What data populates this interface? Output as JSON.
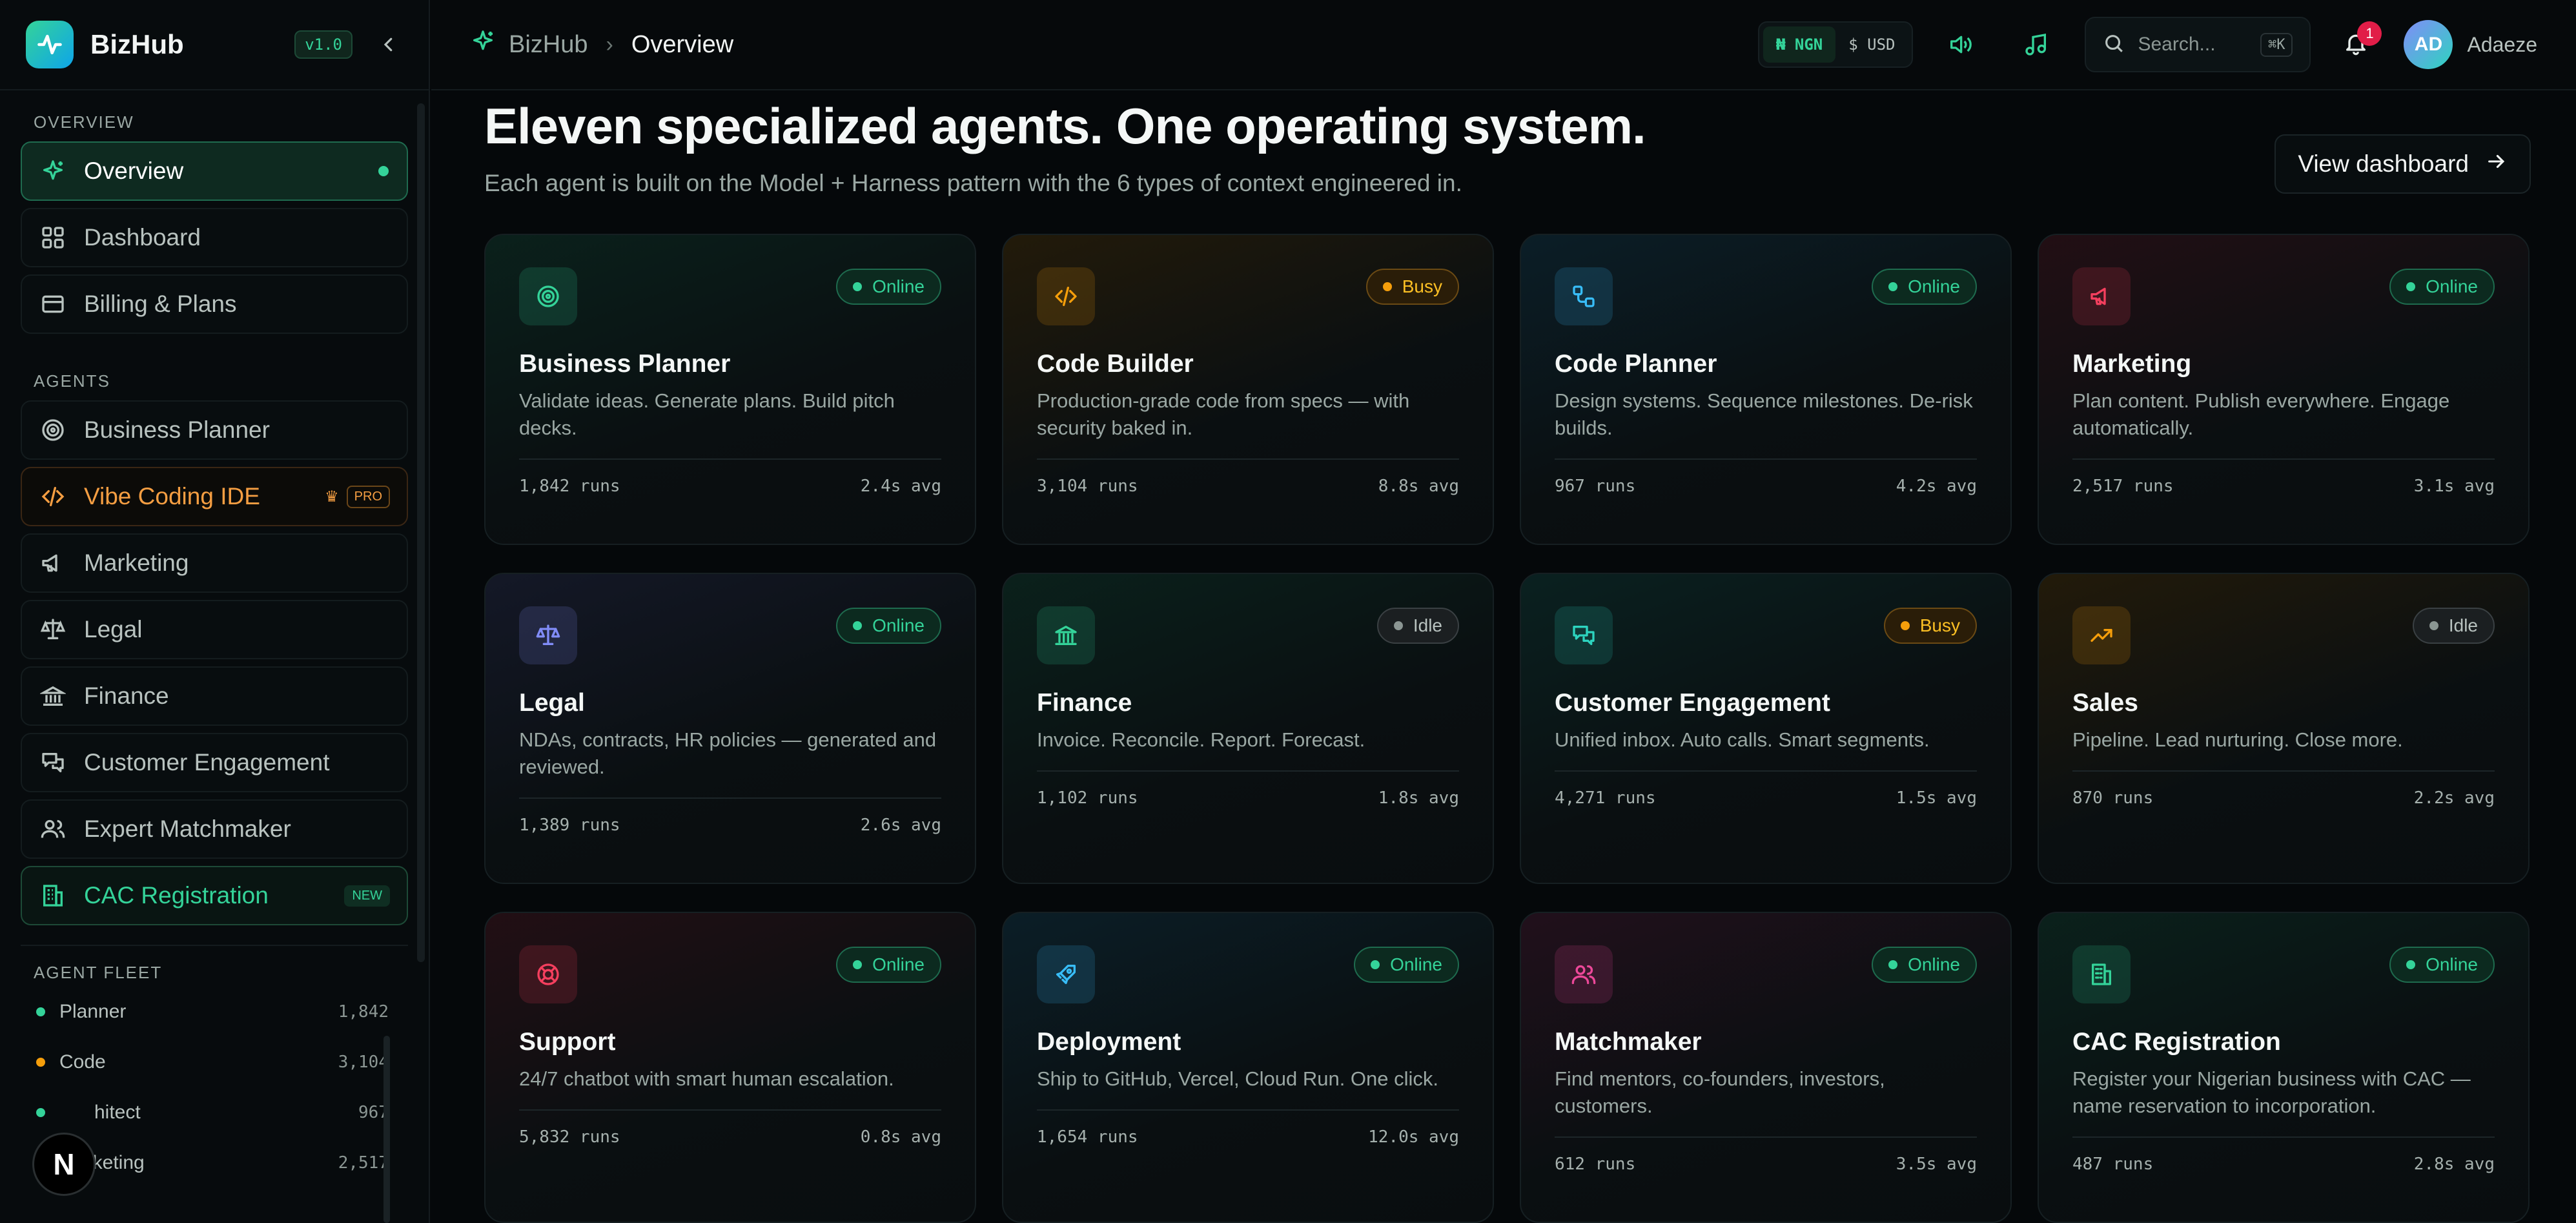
{
  "brand": {
    "name": "BizHub",
    "version": "v1.0"
  },
  "sidebar": {
    "sections": {
      "overview": "OVERVIEW",
      "agents": "AGENTS",
      "fleet": "AGENT FLEET"
    },
    "overview_items": [
      {
        "label": "Overview",
        "icon": "sparkle-icon"
      },
      {
        "label": "Dashboard",
        "icon": "grid-icon"
      },
      {
        "label": "Billing & Plans",
        "icon": "card-icon"
      }
    ],
    "agent_items": [
      {
        "label": "Business Planner",
        "icon": "target-icon"
      },
      {
        "label": "Vibe Coding IDE",
        "icon": "code-icon",
        "badge": "PRO"
      },
      {
        "label": "Marketing",
        "icon": "megaphone-icon"
      },
      {
        "label": "Legal",
        "icon": "scale-icon"
      },
      {
        "label": "Finance",
        "icon": "bank-icon"
      },
      {
        "label": "Customer Engagement",
        "icon": "chat-icon"
      },
      {
        "label": "Expert Matchmaker",
        "icon": "users-icon"
      },
      {
        "label": "CAC Registration",
        "icon": "building-icon",
        "badge": "NEW"
      }
    ],
    "fleet": [
      {
        "name": "Planner",
        "count": "1,842",
        "color": "#34d399"
      },
      {
        "name": "Code",
        "count": "3,104",
        "color": "#f59e0b"
      },
      {
        "name": "hitect",
        "count": "967",
        "color": "#34d399"
      },
      {
        "name": "Marketing",
        "count": "2,517",
        "color": "#34d399"
      }
    ],
    "n_badge": "N"
  },
  "topbar": {
    "breadcrumb_home": "BizHub",
    "breadcrumb_current": "Overview",
    "currency": [
      "₦ NGN",
      "$ USD"
    ],
    "search_placeholder": "Search...",
    "search_shortcut": "⌘K",
    "notifications": "1",
    "avatar_initials": "AD",
    "user_name": "Adaeze"
  },
  "main": {
    "headline": "Eleven specialized agents. One operating system.",
    "subhead": "Each agent is built on the Model + Harness pattern with the 6 types of context engineered in.",
    "view_button": "View dashboard"
  },
  "cards": [
    {
      "title": "Business Planner",
      "desc": "Validate ideas. Generate plans. Build pitch decks.",
      "status": "Online",
      "runs": "1,842 runs",
      "avg": "2.4s avg",
      "icon": "target-icon",
      "accent": "#34d399"
    },
    {
      "title": "Code Builder",
      "desc": "Production-grade code from specs — with security baked in.",
      "status": "Busy",
      "runs": "3,104 runs",
      "avg": "8.8s avg",
      "icon": "code-icon",
      "accent": "#f59e0b"
    },
    {
      "title": "Code Planner",
      "desc": "Design systems. Sequence milestones. De-risk builds.",
      "status": "Online",
      "runs": "967 runs",
      "avg": "4.2s avg",
      "icon": "flow-icon",
      "accent": "#38bdf8"
    },
    {
      "title": "Marketing",
      "desc": "Plan content. Publish everywhere. Engage automatically.",
      "status": "Online",
      "runs": "2,517 runs",
      "avg": "3.1s avg",
      "icon": "megaphone-icon",
      "accent": "#f43f5e"
    },
    {
      "title": "Legal",
      "desc": "NDAs, contracts, HR policies — generated and reviewed.",
      "status": "Online",
      "runs": "1,389 runs",
      "avg": "2.6s avg",
      "icon": "scale-icon",
      "accent": "#818cf8"
    },
    {
      "title": "Finance",
      "desc": "Invoice. Reconcile. Report. Forecast.",
      "status": "Idle",
      "runs": "1,102 runs",
      "avg": "1.8s avg",
      "icon": "bank-icon",
      "accent": "#34d399"
    },
    {
      "title": "Customer Engagement",
      "desc": "Unified inbox. Auto calls. Smart segments.",
      "status": "Busy",
      "runs": "4,271 runs",
      "avg": "1.5s avg",
      "icon": "chat-icon",
      "accent": "#2dd4bf"
    },
    {
      "title": "Sales",
      "desc": "Pipeline. Lead nurturing. Close more.",
      "status": "Idle",
      "runs": "870 runs",
      "avg": "2.2s avg",
      "icon": "trend-icon",
      "accent": "#f59e0b"
    },
    {
      "title": "Support",
      "desc": "24/7 chatbot with smart human escalation.",
      "status": "Online",
      "runs": "5,832 runs",
      "avg": "0.8s avg",
      "icon": "lifebuoy-icon",
      "accent": "#f43f5e"
    },
    {
      "title": "Deployment",
      "desc": "Ship to GitHub, Vercel, Cloud Run. One click.",
      "status": "Online",
      "runs": "1,654 runs",
      "avg": "12.0s avg",
      "icon": "rocket-icon",
      "accent": "#38bdf8"
    },
    {
      "title": "Matchmaker",
      "desc": "Find mentors, co-founders, investors, customers.",
      "status": "Online",
      "runs": "612 runs",
      "avg": "3.5s avg",
      "icon": "users-icon",
      "accent": "#ec4899"
    },
    {
      "title": "CAC Registration",
      "desc": "Register your Nigerian business with CAC — name reservation to incorporation.",
      "status": "Online",
      "runs": "487 runs",
      "avg": "2.8s avg",
      "icon": "building-icon",
      "accent": "#34d399"
    }
  ],
  "colors": {
    "accent": "#34d399",
    "busy": "#f59e0b",
    "pro": "#f59e42",
    "alert": "#e11d48"
  }
}
